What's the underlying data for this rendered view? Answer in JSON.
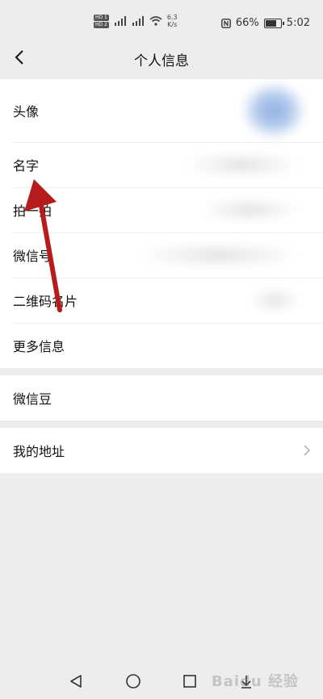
{
  "status_bar": {
    "hd1": "HD 1",
    "hd2": "HD 2",
    "net_speed_value": "6.3",
    "net_speed_unit": "K/s",
    "battery": "66%",
    "time": "5:02"
  },
  "header": {
    "title": "个人信息"
  },
  "profile_group": {
    "items": [
      {
        "label": "头像"
      },
      {
        "label": "名字"
      },
      {
        "label": "拍一拍"
      },
      {
        "label": "微信号"
      },
      {
        "label": "二维码名片"
      },
      {
        "label": "更多信息"
      }
    ]
  },
  "bean_group": {
    "label": "微信豆"
  },
  "address_group": {
    "label": "我的地址"
  },
  "watermark": "Baidu 经验",
  "annotation": {
    "arrow_color": "#b71c1c"
  }
}
